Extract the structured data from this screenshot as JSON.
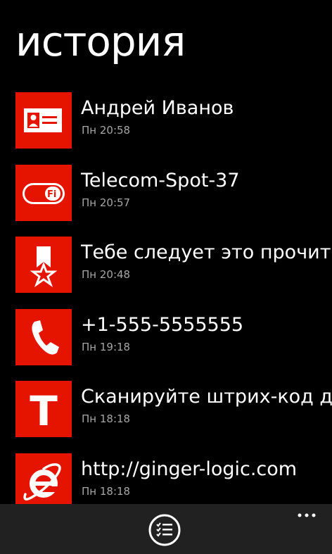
{
  "page": {
    "title": "история"
  },
  "history": [
    {
      "title": "Андрей Иванов",
      "time": "Пн 20:58",
      "icon": "contact-card-icon"
    },
    {
      "title": "Telecom-Spot-37",
      "time": "Пн 20:57",
      "icon": "wifi-icon"
    },
    {
      "title": "Тебе следует это прочитать",
      "time": "Пн 20:48",
      "icon": "bookmark-star-icon"
    },
    {
      "title": "+1-555-5555555",
      "time": "Пн 19:18",
      "icon": "phone-icon"
    },
    {
      "title": "Сканируйте штрих-код для",
      "time": "Пн 18:18",
      "icon": "text-icon"
    },
    {
      "title": "http://ginger-logic.com",
      "time": "Пн 18:18",
      "icon": "internet-explorer-icon"
    }
  ],
  "icon_labels": {
    "wifi_text": "Wi Fi",
    "text_glyph": "T"
  },
  "appbar": {
    "button_icon": "checklist-icon",
    "more_icon": "ellipsis-icon"
  },
  "colors": {
    "tile": "#e51400",
    "background": "#000000",
    "appbar": "#212121",
    "subtext": "#a6a6a6"
  }
}
